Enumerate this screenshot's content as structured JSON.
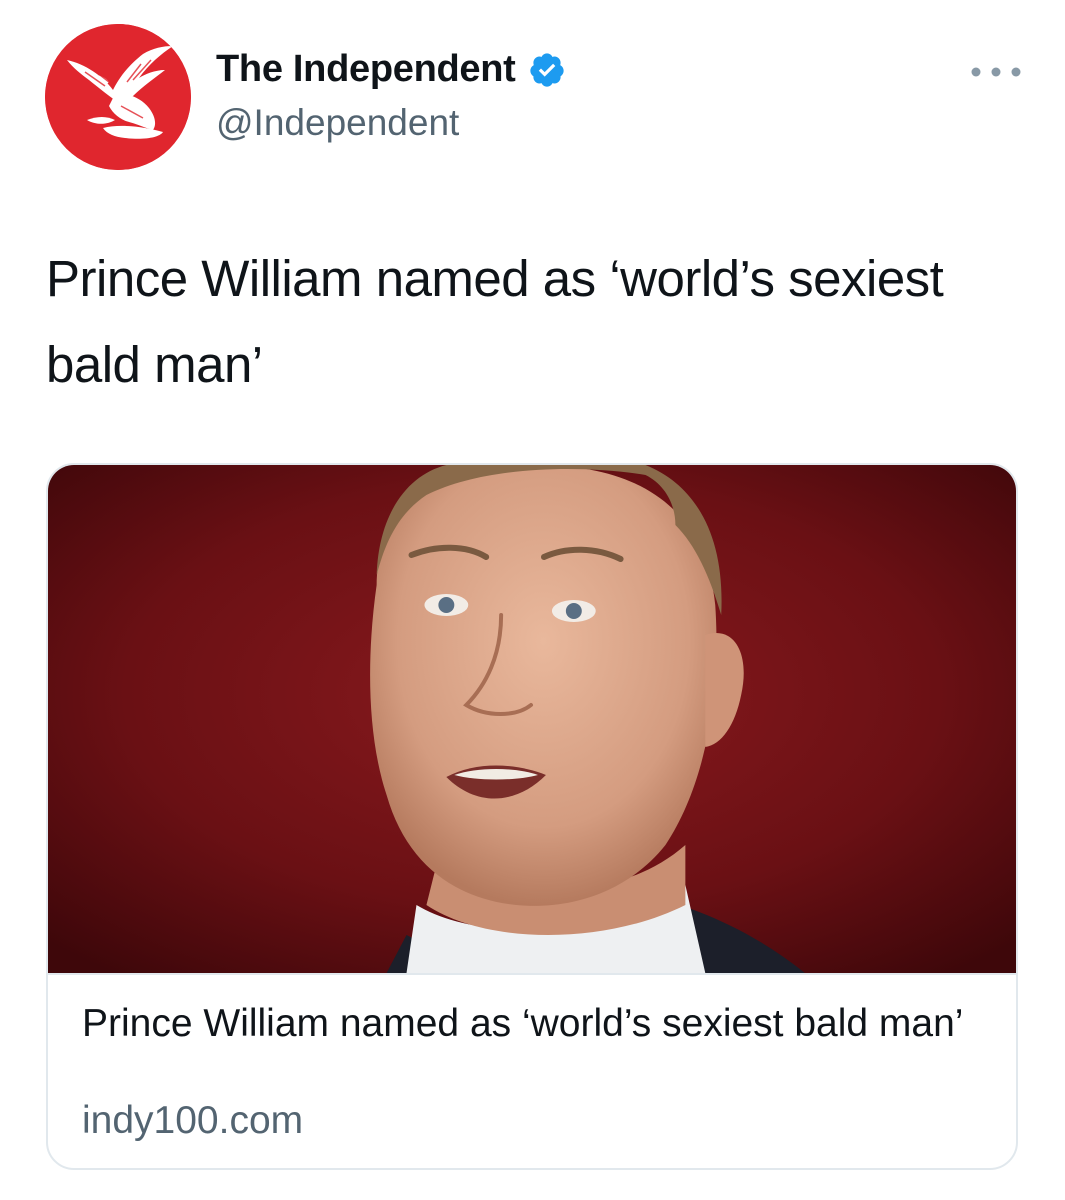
{
  "author": {
    "display_name": "The Independent",
    "handle": "@Independent",
    "verified": true,
    "avatar_icon": "eagle-logo-icon",
    "avatar_color": "#e0262e"
  },
  "tweet": {
    "text": "Prince William named as ‘world’s sexiest bald man’"
  },
  "card": {
    "image_description_icon": "portrait-photo",
    "title": "Prince William named as ‘world’s sexiest bald man’",
    "domain": "indy100.com"
  },
  "colors": {
    "verified_blue": "#1d9bf0",
    "secondary_text": "#536471",
    "card_border": "#e1e8ed"
  },
  "icons": {
    "more": "more-dots-icon",
    "verified": "verified-badge-icon"
  }
}
